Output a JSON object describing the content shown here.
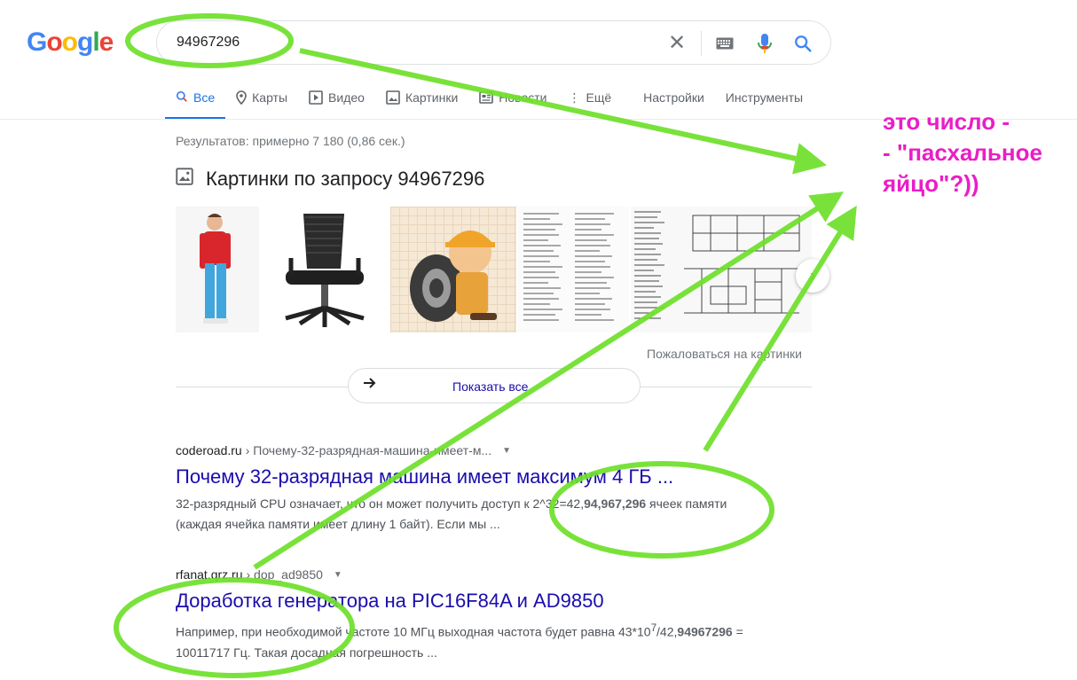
{
  "search": {
    "query": "94967296"
  },
  "tabs": [
    {
      "label": "Все",
      "icon": "search-icon"
    },
    {
      "label": "Карты",
      "icon": "pin-icon"
    },
    {
      "label": "Видео",
      "icon": "play-icon"
    },
    {
      "label": "Картинки",
      "icon": "image-icon"
    },
    {
      "label": "Новости",
      "icon": "news-icon"
    },
    {
      "label": "Ещё",
      "icon": "more-icon"
    }
  ],
  "tools": {
    "settings": "Настройки",
    "instruments": "Инструменты"
  },
  "stats": "Результатов: примерно 7 180 (0,86 сек.)",
  "images": {
    "heading": "Картинки по запросу 94967296",
    "report": "Пожаловаться на картинки",
    "show_all": "Показать все"
  },
  "results": [
    {
      "domain": "coderoad.ru",
      "path": "› Почему-32-разрядная-машина-имеет-м...",
      "title": "Почему 32-разрядная машина имеет максимум 4 ГБ ...",
      "snippet_pre": "32-разрядный CPU означает, что он может получить доступ к 2^32=42,",
      "snippet_bold": "94,967,296",
      "snippet_post": " ячеек памяти (каждая ячейка памяти имеет длину 1 байт). Если мы ..."
    },
    {
      "domain": "rfanat.qrz.ru",
      "path": "› dop_ad9850",
      "title": "Доработка генератора на PIC16F84A и AD9850",
      "snippet_pre": "Например, при необходимой частоте 10 МГц выходная частота будет равна 43*10",
      "snippet_sup": "7",
      "snippet_mid": "/42,",
      "snippet_bold": "94967296",
      "snippet_post": " = 10011717 Гц. Такая досадная погрешность ..."
    }
  ],
  "annotation": {
    "text": "это число -\n- \"пасхальное\nяйцо\"?))",
    "color": "#e91ec6",
    "arrow_color": "#6ee02a"
  }
}
